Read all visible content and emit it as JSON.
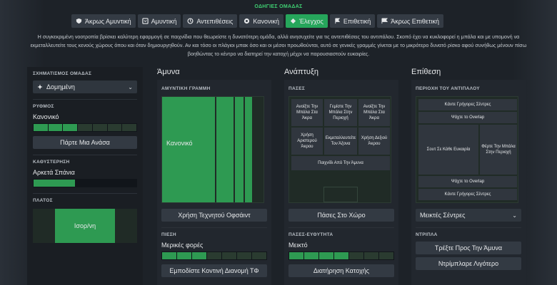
{
  "title": "ΟΔΗΓΙΕΣ ΟΜΑΔΑΣ",
  "mentality": [
    {
      "label": "Άκρως Αμυντική",
      "icon": "shield-heart-icon",
      "active": false
    },
    {
      "label": "Αμυντική",
      "icon": "shield-icon",
      "active": false
    },
    {
      "label": "Αντεπιθέσεις",
      "icon": "counter-icon",
      "active": false
    },
    {
      "label": "Κανονική",
      "icon": "balanced-icon",
      "active": false
    },
    {
      "label": "Έλεγχος",
      "icon": "control-icon",
      "active": true
    },
    {
      "label": "Επιθετική",
      "icon": "attack-icon",
      "active": false
    },
    {
      "label": "Άκρως Επιθετική",
      "icon": "very-attack-icon",
      "active": false
    }
  ],
  "description": "Η συγκεκριμένη νοοτροπία βρίσκει καλύτερη εφαρμογή σε παιχνίδια που θεωρείστε η δυνατότερη ομάδα, αλλά ανησυχείτε για τις αντεπιθέσεις του αντιπάλου. Σκοπό έχει να κυκλοφορεί η μπάλα και με υπομονή να εκμεταλλευτείτε τους κενούς χώρους όπου και όταν δημιουργηθούν. Αν και τόσο οι πλάγιοι μπακ όσο και οι μέσοι προωθούνται, αυτό σε γενικές γραμμές γίνεται με το μικρότερο δυνατό ρίσκο αφού συνήθως μένουν πίσω βοηθώντας το κέντρο να διατηρεί την κατοχή μέχρι να παρουσιαστούν ευκαιρίες.",
  "left": {
    "shape_label": "ΣΧΗΜΑΤΙΣΜΟΣ ΟΜΑΔΑΣ",
    "shape_value": "Δομημένη",
    "tempo_label": "ΡΥΘΜΟΣ",
    "tempo_value": "Κανονικό",
    "tempo_level": 0.43,
    "breather_button": "Πάρτε Μια Ανάσα",
    "timewasting_label": "ΚΑΘΥΣΤΕΡΗΣΗ",
    "timewasting_value": "Αρκετά Σπάνια",
    "timewasting_level": 0.4,
    "width_label": "ΠΛΑΤΟΣ",
    "width_value": "Ισορ/νη"
  },
  "defence": {
    "header": "Άμυνα",
    "line_label": "ΑΜΥΝΤΙΚΗ ΓΡΑΜΜΗ",
    "line_value": "Κανονικό",
    "offside_button": "Χρήση Τεχνητού Οφσάιντ",
    "press_label": "ΠΙΕΣΗ",
    "press_value": "Μερικές φορές",
    "press_level": 0.4,
    "press_button": "Εμποδίστε Κοντινή Διανομή ΤΦ"
  },
  "transition": {
    "header": "Ανάπτυξη",
    "passes_label": "ΠΑΣΕΣ",
    "zones": {
      "z1": "Ανοίξτε Την Μπάλα Στα Άκρα",
      "z2": "Γεμίστε Την Μπάλα Στην Περιοχή",
      "z3": "Ανοίξτε Την Μπάλα Στα Άκρα",
      "z4": "Χρήση Αριστερού Άκρου",
      "z5": "Εκμεταλλευτείτε Τον Άξονα",
      "z6": "Χρήση Δεξιού Άκρου",
      "z7": "Παιχνίδι Από Την Άμυνα"
    },
    "space_button": "Πάσες Στο Χώρο",
    "directness_label": "ΠΑΣΕΣ-ΕΥΘΥΤΗΤΑ",
    "directness_value": "Μεικτό",
    "directness_level": 0.5,
    "possession_button": "Διατήρηση Κατοχής"
  },
  "attack": {
    "header": "Επίθεση",
    "area_label": "ΠΕΡΙΟΧΗ ΤΟΥ ΑΝΤΙΠΑΛΟΥ",
    "zones": {
      "a1": "Κάντε Γρήγορες Σέντρες",
      "a2": "Ψάχτε το Overlap",
      "a3": "Σουτ Σε Κάθε Ευκαιρία",
      "a4": "Φέρτε Την Μπάλα Στην Περιοχή",
      "a5": "Ψάχτε το Overlap",
      "a6": "Κάντε Γρήγορες Σέντρες"
    },
    "cross_select": "Μεικτές Σέντρες",
    "dribble_label": "ΝΤΡΙΠΛΑ",
    "dribble_button_1": "Τρέξτε Προς Την Άμυνα",
    "dribble_button_2": "Ντρίμπλαρε Λιγότερο"
  },
  "colors": {
    "accent": "#2e9a52",
    "active_tab": "#26a65b",
    "title": "#3fcf72"
  }
}
